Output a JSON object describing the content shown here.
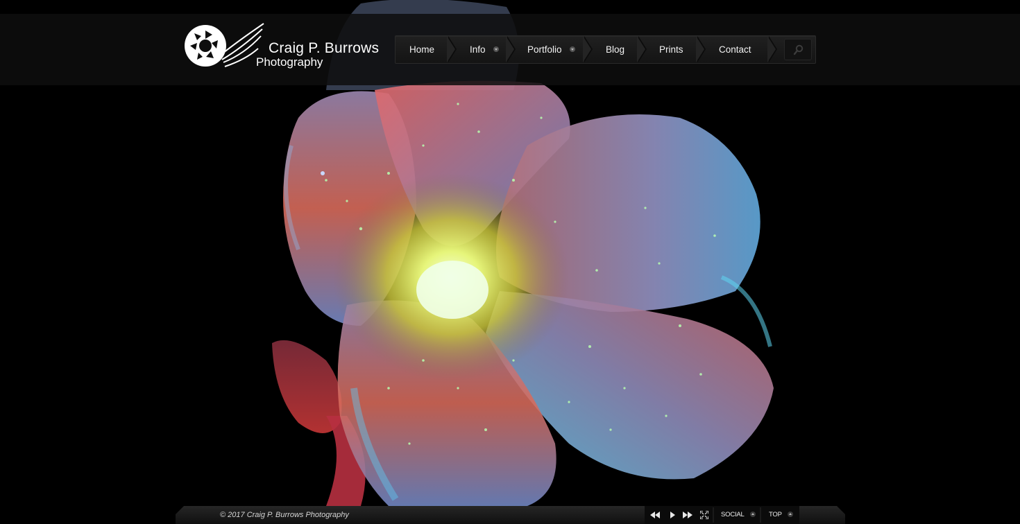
{
  "site": {
    "logo_name": "Craig P. Burrows",
    "logo_sub": "Photography"
  },
  "nav": {
    "items": [
      {
        "label": "Home",
        "has_dropdown": false
      },
      {
        "label": "Info",
        "has_dropdown": true
      },
      {
        "label": "Portfolio",
        "has_dropdown": true
      },
      {
        "label": "Blog",
        "has_dropdown": false
      },
      {
        "label": "Prints",
        "has_dropdown": false
      },
      {
        "label": "Contact",
        "has_dropdown": false
      }
    ],
    "search_icon": "search-icon"
  },
  "hero": {
    "subject": "ultraviolet-fluorescence-flower"
  },
  "footer": {
    "copyright": "© 2017 Craig P. Burrows Photography",
    "controls": {
      "prev_icon": "rewind-icon",
      "play_icon": "play-icon",
      "next_icon": "fast-forward-icon",
      "fullscreen_icon": "fullscreen-icon",
      "social_label": "SOCIAL",
      "top_label": "TOP"
    }
  },
  "colors": {
    "background": "#000000",
    "header": "#0e0e0e",
    "nav_bg": "#1a1a1a",
    "text": "#ffffff"
  }
}
